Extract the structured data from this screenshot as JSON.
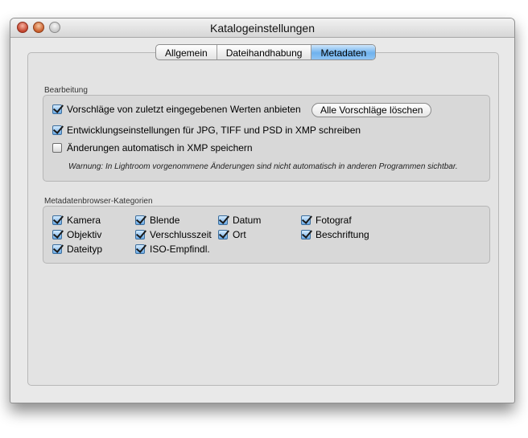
{
  "window": {
    "title": "Katalogeinstellungen"
  },
  "tabs": [
    {
      "label": "Allgemein",
      "active": false
    },
    {
      "label": "Dateihandhabung",
      "active": false
    },
    {
      "label": "Metadaten",
      "active": true
    }
  ],
  "bearbeitung": {
    "label": "Bearbeitung",
    "options": [
      {
        "label": "Vorschläge von zuletzt eingegebenen Werten anbieten",
        "checked": true
      },
      {
        "label": "Entwicklungseinstellungen für JPG, TIFF und PSD in XMP schreiben",
        "checked": true
      },
      {
        "label": "Änderungen automatisch in XMP speichern",
        "checked": false
      }
    ],
    "clear_button": "Alle Vorschläge löschen",
    "warning": "Warnung: In Lightroom vorgenommene Änderungen sind nicht automatisch in anderen Programmen sichtbar."
  },
  "kategorien": {
    "label": "Metadatenbrowser-Kategorien",
    "items": [
      {
        "label": "Kamera",
        "checked": true
      },
      {
        "label": "Objektiv",
        "checked": true
      },
      {
        "label": "Dateityp",
        "checked": true
      },
      {
        "label": "Blende",
        "checked": true
      },
      {
        "label": "Verschlusszeit",
        "checked": true
      },
      {
        "label": "ISO-Empfindl.",
        "checked": true
      },
      {
        "label": "Datum",
        "checked": true
      },
      {
        "label": "Ort",
        "checked": true
      },
      {
        "label": "Fotograf",
        "checked": true
      },
      {
        "label": "Beschriftung",
        "checked": true
      }
    ]
  }
}
